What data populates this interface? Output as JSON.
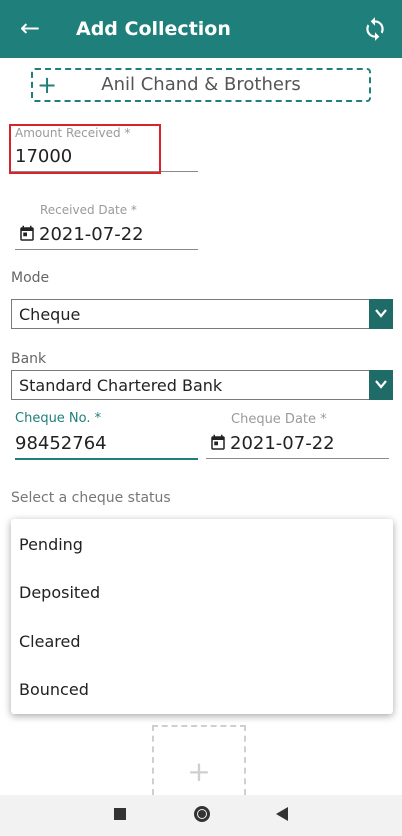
{
  "header": {
    "title": "Add Collection",
    "back_icon": "arrow-left-icon",
    "sync_icon": "sync-icon"
  },
  "customer": {
    "name": "Anil Chand & Brothers"
  },
  "amount": {
    "label": "Amount Received *",
    "value": "17000"
  },
  "received_date": {
    "label": "Received Date *",
    "value": "2021-07-22"
  },
  "mode": {
    "label": "Mode",
    "value": "Cheque"
  },
  "bank": {
    "label": "Bank",
    "value": "Standard Chartered Bank"
  },
  "cheque": {
    "no_label": "Cheque No. *",
    "no_value": "98452764",
    "date_label": "Cheque Date *",
    "date_value": "2021-07-22"
  },
  "cheque_status": {
    "label": "Select a cheque status",
    "options": [
      "Pending",
      "Deposited",
      "Cleared",
      "Bounced"
    ]
  },
  "colors": {
    "primary": "#1f7f7a",
    "highlight": "#d9232a"
  }
}
